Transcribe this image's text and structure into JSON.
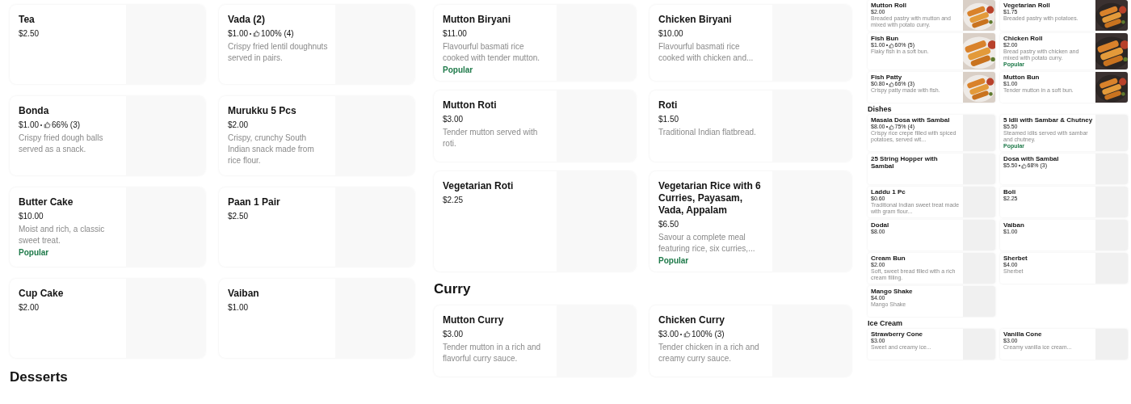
{
  "panels": [
    {
      "sections": [
        {
          "items": [
            {
              "name": "Tea",
              "price": "$2.50",
              "photo": false
            },
            {
              "name": "Vada (2)",
              "price": "$1.00",
              "rating": "100% (4)",
              "description": "Crispy fried lentil doughnuts served in pairs.",
              "photo": false
            },
            {
              "name": "Bonda",
              "price": "$1.00",
              "rating": "66% (3)",
              "description": "Crispy fried dough balls served as a snack.",
              "photo": false
            },
            {
              "name": "Murukku 5 Pcs",
              "price": "$2.00",
              "description": "Crispy, crunchy South Indian snack made from rice flour.",
              "photo": false
            },
            {
              "name": "Butter Cake",
              "price": "$10.00",
              "description": "Moist and rich, a classic sweet treat.",
              "badge": "Popular",
              "photo": false
            },
            {
              "name": "Paan 1 Pair",
              "price": "$2.50",
              "photo": false
            },
            {
              "name": "Cup Cake",
              "price": "$2.00",
              "photo": false
            },
            {
              "name": "Vaiban",
              "price": "$1.00",
              "photo": false
            }
          ]
        },
        {
          "heading": "Desserts"
        }
      ]
    },
    {
      "sections": [
        {
          "items": [
            {
              "name": "Mutton Biryani",
              "price": "$11.00",
              "description": "Flavourful basmati rice cooked with tender mutton.",
              "badge": "Popular",
              "photo": false
            },
            {
              "name": "Chicken Biryani",
              "price": "$10.00",
              "description": "Flavourful basmati rice cooked with chicken and...",
              "photo": false
            },
            {
              "name": "Mutton Roti",
              "price": "$3.00",
              "description": "Tender mutton served with roti.",
              "photo": false
            },
            {
              "name": "Roti",
              "price": "$1.50",
              "description": "Traditional Indian flatbread.",
              "photo": false
            },
            {
              "name": "Vegetarian Roti",
              "price": "$2.25",
              "photo": false
            },
            {
              "name": "Vegetarian Rice with 6 Curries, Payasam, Vada, Appalam",
              "price": "$6.50",
              "description": "Savour a complete meal featuring rice, six curries,...",
              "badge": "Popular",
              "photo": false
            }
          ]
        },
        {
          "heading": "Curry",
          "items": [
            {
              "name": "Mutton Curry",
              "price": "$3.00",
              "description": "Tender mutton in a rich and flavorful curry sauce.",
              "photo": false
            },
            {
              "name": "Chicken Curry",
              "price": "$3.00",
              "rating": "100% (3)",
              "description": "Tender chicken in a rich and creamy curry sauce.",
              "photo": false
            }
          ]
        }
      ]
    },
    {
      "sections": [
        {
          "items": [
            {
              "name": "Mutton Roll",
              "price": "$2.00",
              "description": "Breaded pastry with mutton and mixed with potato curry.",
              "photo": true
            },
            {
              "name": "Vegetarian Roll",
              "price": "$1.75",
              "description": "Breaded pastry with potatoes.",
              "photo": true
            },
            {
              "name": "Fish Bun",
              "price": "$1.00",
              "rating": "60% (5)",
              "description": "Flaky fish in a soft bun.",
              "photo": true
            },
            {
              "name": "Chicken Roll",
              "price": "$2.00",
              "description": "Bread pastry with chicken and mixed with potato curry.",
              "badge": "Popular",
              "photo": true
            },
            {
              "name": "Fish Patty",
              "price": "$0.80",
              "rating": "66% (3)",
              "description": "Crispy patty made with fish.",
              "photo": true
            },
            {
              "name": "Mutton Bun",
              "price": "$1.00",
              "description": "Tender mutton in a soft bun.",
              "photo": true
            }
          ]
        },
        {
          "heading": "Dishes",
          "items": [
            {
              "name": "Masala Dosa with Sambal",
              "price": "$8.00",
              "rating": "75% (4)",
              "description": "Crispy rice crepe filled with spiced potatoes, served wit...",
              "photo": false
            },
            {
              "name": "5 Idli with Sambar & Chutney",
              "price": "$5.50",
              "description": "Steamed idlis served with sambar and chutney.",
              "badge": "Popular",
              "photo": false
            },
            {
              "name": "25 String Hopper with Sambal",
              "photo": false
            },
            {
              "name": "Dosa with Sambal",
              "price": "$5.50",
              "rating": "68% (3)",
              "photo": false
            },
            {
              "name": "Laddu 1 Pc",
              "price": "$0.60",
              "description": "Traditional Indian sweet treat made with gram flour...",
              "photo": false
            },
            {
              "name": "Boli",
              "price": "$2.25",
              "photo": false
            },
            {
              "name": "Dodal",
              "price": "$8.00",
              "photo": false
            },
            {
              "name": "Vaiban",
              "price": "$1.00",
              "photo": false
            },
            {
              "name": "Cream Bun",
              "price": "$2.00",
              "description": "Soft, sweet bread filled with a rich cream filling.",
              "photo": false
            },
            {
              "name": "Sherbet",
              "price": "$4.00",
              "description": "Sherbet",
              "photo": false
            },
            {
              "name": "Mango Shake",
              "price": "$4.00",
              "description": "Mango Shake",
              "photo": false
            }
          ]
        },
        {
          "heading": "Ice Cream",
          "items": [
            {
              "name": "Strawberry Cone",
              "price": "$3.00",
              "description": "Sweet and creamy ice...",
              "photo": false
            },
            {
              "name": "Vanilla Cone",
              "price": "$3.00",
              "description": "Creamy vanilla ice cream...",
              "photo": false
            }
          ]
        }
      ]
    }
  ]
}
